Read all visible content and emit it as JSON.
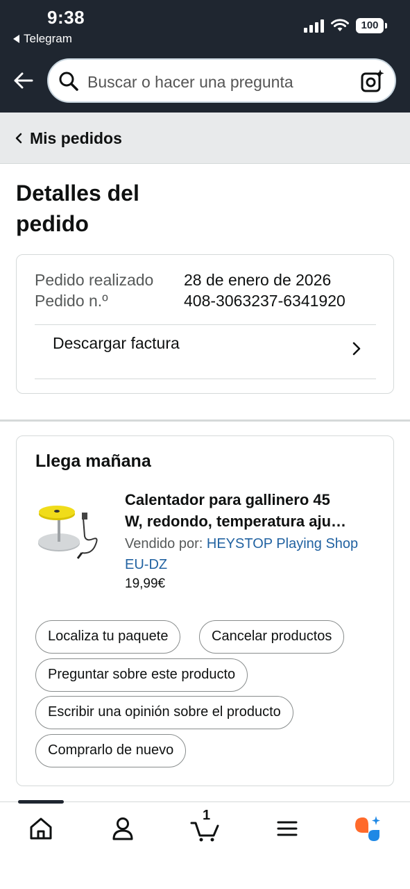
{
  "status_bar": {
    "time": "9:38",
    "back_app": "Telegram",
    "battery": "100"
  },
  "search": {
    "placeholder": "Buscar o hacer una pregunta"
  },
  "breadcrumb": {
    "label": "Mis pedidos"
  },
  "page": {
    "title_line1": "Detalles del",
    "title_line2": "pedido"
  },
  "order_info": {
    "placed_label": "Pedido realizado",
    "placed_value": "28 de enero de 2026",
    "number_label": "Pedido n.º",
    "number_value": "408-3063237-6341920",
    "invoice_label": "Descargar factura"
  },
  "shipment": {
    "status": "Llega mañana",
    "product": {
      "title_line1": "Calentador para gallinero 45",
      "title_line2": "W, redondo, temperatura aju…",
      "seller_prefix": "Vendido por: ",
      "seller_line1": "HEYSTOP Playing Shop",
      "seller_line2": "EU-DZ",
      "price": "19,99€"
    },
    "actions": {
      "track": "Localiza tu paquete",
      "cancel": "Cancelar productos",
      "ask": "Preguntar sobre este producto",
      "review": "Escribir una opinión sobre el producto",
      "buy_again": "Comprarlo de nuevo"
    }
  },
  "bottom_nav": {
    "items": [
      "home-icon",
      "account-icon",
      "cart-icon",
      "menu-icon",
      "assistant-icon"
    ],
    "cart_count": "1"
  },
  "colors": {
    "header_bg": "#1f2630",
    "link": "#2162a1",
    "assistant_orange": "#ff6a2b",
    "assistant_blue": "#1e88e5"
  }
}
